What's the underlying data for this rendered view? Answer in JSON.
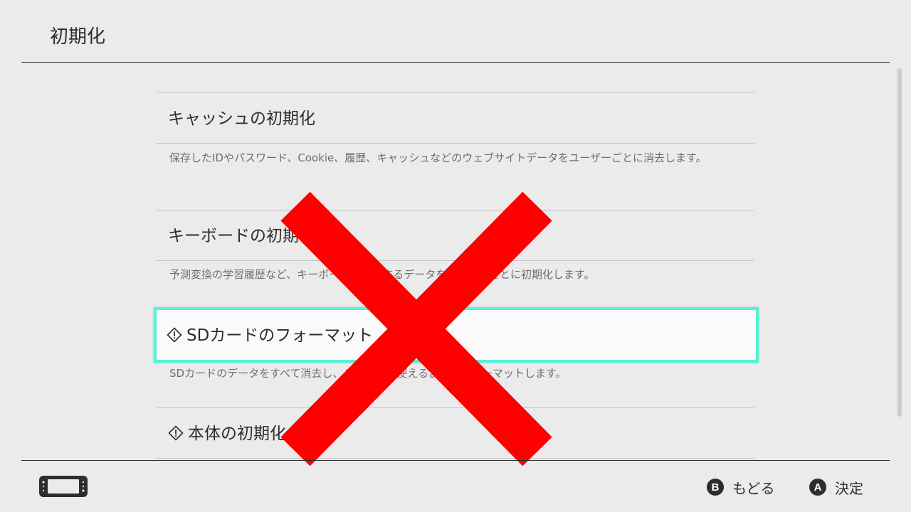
{
  "header": {
    "title": "初期化"
  },
  "items": [
    {
      "label": "キャッシュの初期化",
      "description": "保存したIDやパスワード、Cookie、履歴、キャッシュなどのウェブサイトデータをユーザーごとに消去します。",
      "warning": false
    },
    {
      "label": "キーボードの初期化",
      "description": "予測変換の学習履歴など、キーボードに関連するデータをユーザーごとに初期化します。",
      "warning": false
    },
    {
      "label": "SDカードのフォーマット",
      "description": "SDカードのデータをすべて消去し、この本体で使えるようにフォーマットします。",
      "warning": true,
      "selected": true
    },
    {
      "label": "本体の初期化",
      "warning": true
    }
  ],
  "footer": {
    "back_button_glyph": "B",
    "back_label": "もどる",
    "confirm_button_glyph": "A",
    "confirm_label": "決定"
  },
  "colors": {
    "selection_border": "#52f2d7",
    "overlay_cross": "#ff0000",
    "background": "#ebebeb"
  },
  "icons": {
    "warning": "warning-diamond-icon",
    "console": "console-handheld-icon"
  }
}
